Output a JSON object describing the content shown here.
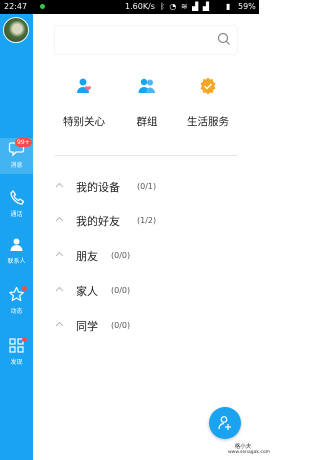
{
  "status_bar": {
    "time": "22:47",
    "network_rate": "1.60K/s",
    "battery": "59%"
  },
  "sidebar": {
    "items": [
      {
        "label": "消息",
        "badge": "99+",
        "icon": "message-icon"
      },
      {
        "label": "通话",
        "icon": "phone-icon"
      },
      {
        "label": "联系人",
        "icon": "contacts-icon"
      },
      {
        "label": "动态",
        "icon": "star-icon"
      },
      {
        "label": "发现",
        "icon": "grid-icon"
      }
    ]
  },
  "quick_actions": [
    {
      "label": "特别关心",
      "icon": "special-care-icon"
    },
    {
      "label": "群组",
      "icon": "group-icon"
    },
    {
      "label": "生活服务",
      "icon": "life-service-icon"
    }
  ],
  "groups": [
    {
      "name": "我的设备",
      "count": "(0/1)"
    },
    {
      "name": "我的好友",
      "count": "(1/2)"
    },
    {
      "name": "朋友",
      "count": "(0/0)"
    },
    {
      "name": "家人",
      "count": "(0/0)"
    },
    {
      "name": "同学",
      "count": "(0/0)"
    }
  ],
  "watermark": {
    "title": "格小夫",
    "url": "www.senagak.com"
  },
  "colors": {
    "accent": "#1aa3f0",
    "badge": "#ff4b4b",
    "quick_icon": "#1aa3f0",
    "heart": "#ff6b8a",
    "life": "#f5a623"
  }
}
